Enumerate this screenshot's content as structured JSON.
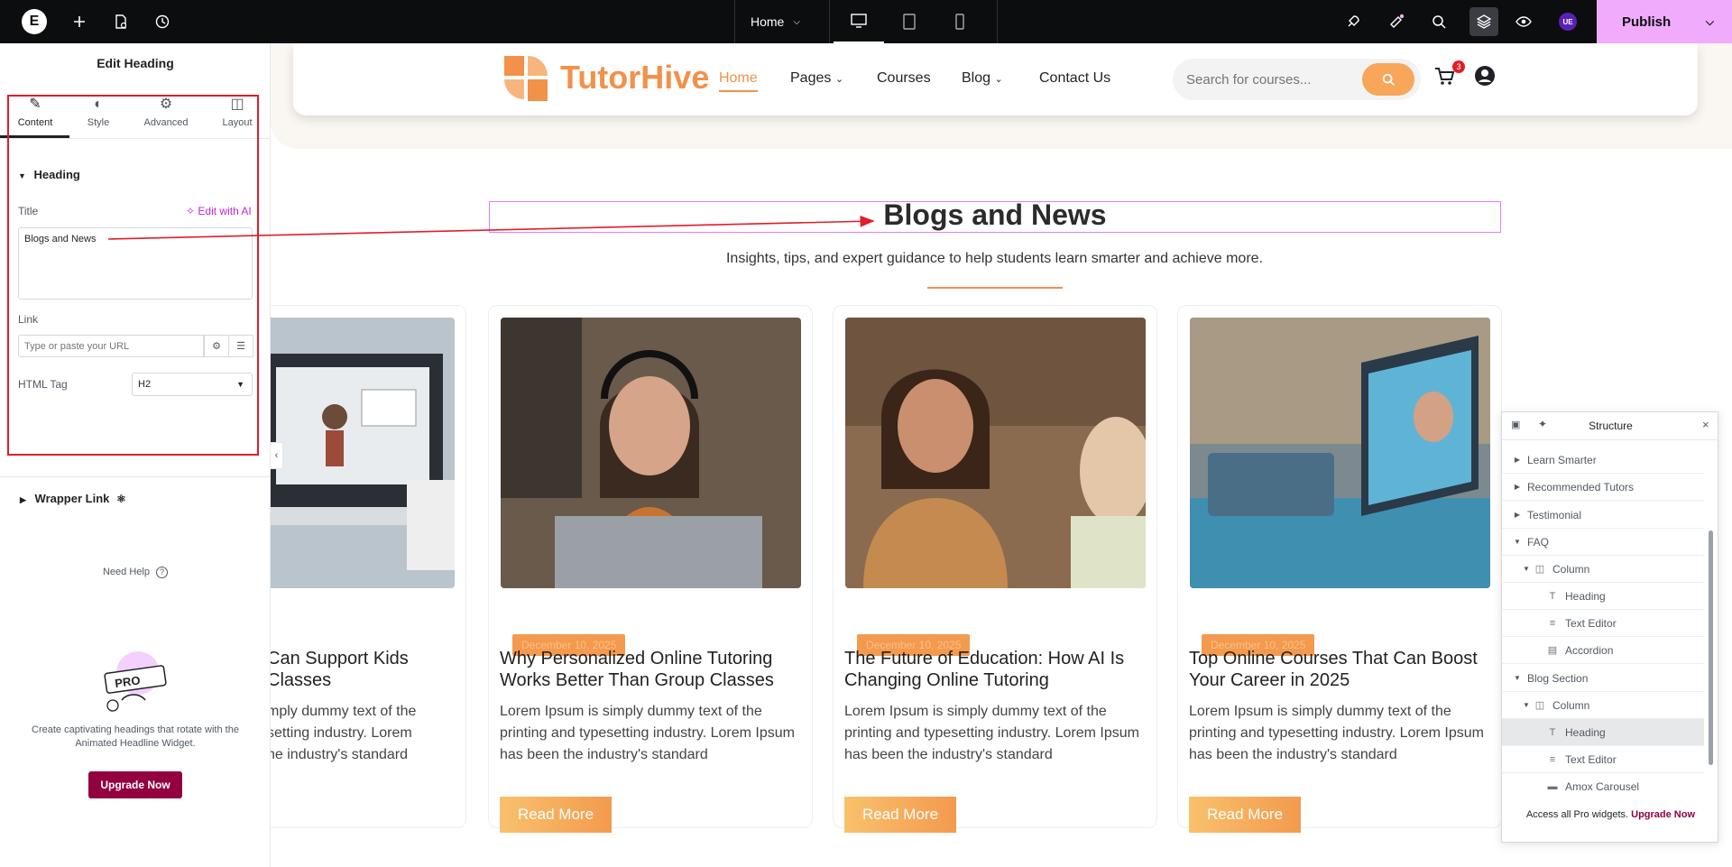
{
  "topbar": {
    "page_name": "Home",
    "publish_label": "Publish",
    "user_initials": "UE"
  },
  "panel": {
    "title": "Edit Heading",
    "tabs": [
      {
        "label": "Content",
        "icon": "pencil-icon"
      },
      {
        "label": "Style",
        "icon": "half-circle-icon"
      },
      {
        "label": "Advanced",
        "icon": "gear-icon"
      },
      {
        "label": "Layout",
        "icon": "layout-icon"
      }
    ],
    "section_heading": "Heading",
    "title_label": "Title",
    "ai_link": "Edit with AI",
    "title_value": "Blogs and News",
    "link_label": "Link",
    "link_placeholder": "Type or paste your URL",
    "html_tag_label": "HTML Tag",
    "html_tag_value": "H2",
    "wrapper_link": "Wrapper Link",
    "need_help": "Need Help",
    "promo_text": "Create captivating headings that rotate with the Animated Headline Widget.",
    "upgrade_label": "Upgrade Now",
    "promo_badge": "PRO"
  },
  "site": {
    "brand": "TutorHive",
    "nav": [
      "Home",
      "Pages",
      "Courses",
      "Blog",
      "Contact Us"
    ],
    "search_placeholder": "Search for courses...",
    "cart_count": "3"
  },
  "blog": {
    "heading": "Blogs and News",
    "subheading": "Insights, tips, and expert guidance to help students learn smarter and achieve more.",
    "cards": [
      {
        "date": "",
        "title": "Can Support Kids\nClasses",
        "text": "mply dummy text of the\nsetting industry. Lorem\nhe industry's standard",
        "button": ""
      },
      {
        "date": "December 10, 2025",
        "title": "Why Personalized Online Tutoring Works Better Than Group Classes",
        "text": "Lorem Ipsum is simply dummy text of the printing and typesetting industry. Lorem Ipsum has been the industry's standard",
        "button": "Read More"
      },
      {
        "date": "December 10, 2025",
        "title": "The Future of Education: How AI Is Changing Online Tutoring",
        "text": "Lorem Ipsum is simply dummy text of the printing and typesetting industry. Lorem Ipsum has been the industry's standard",
        "button": "Read More"
      },
      {
        "date": "December 10, 2025",
        "title": "Top Online Courses That Can Boost Your Career in 2025",
        "text": "Lorem Ipsum is simply dummy text of the printing and typesetting industry. Lorem Ipsum has been the industry's standard",
        "button": "Read More"
      }
    ]
  },
  "structure": {
    "title": "Structure",
    "rows": [
      {
        "label": "Learn Smarter",
        "icon": "",
        "state": "collapsed"
      },
      {
        "label": "Recommended Tutors",
        "icon": "",
        "state": "collapsed"
      },
      {
        "label": "Testimonial",
        "icon": "",
        "state": "collapsed"
      },
      {
        "label": "FAQ",
        "icon": "",
        "state": "expanded"
      },
      {
        "label": "Column",
        "icon": "column-icon",
        "state": "expanded"
      },
      {
        "label": "Heading",
        "icon": "heading-icon",
        "state": "leaf"
      },
      {
        "label": "Text Editor",
        "icon": "text-editor-icon",
        "state": "leaf"
      },
      {
        "label": "Accordion",
        "icon": "accordion-icon",
        "state": "leaf"
      },
      {
        "label": "Blog Section",
        "icon": "",
        "state": "expanded"
      },
      {
        "label": "Column",
        "icon": "column-icon",
        "state": "expanded"
      },
      {
        "label": "Heading",
        "icon": "heading-icon",
        "state": "leaf-selected"
      },
      {
        "label": "Text Editor",
        "icon": "text-editor-icon",
        "state": "leaf"
      },
      {
        "label": "Amox Carousel",
        "icon": "carousel-icon",
        "state": "leaf"
      }
    ],
    "footer_text": "Access all Pro widgets.",
    "footer_link": "Upgrade Now"
  },
  "colors": {
    "accent": "#f2914a",
    "editor_pink": "#f0abfc",
    "annotation_red": "#e11d2a",
    "upgrade": "#93003f"
  }
}
